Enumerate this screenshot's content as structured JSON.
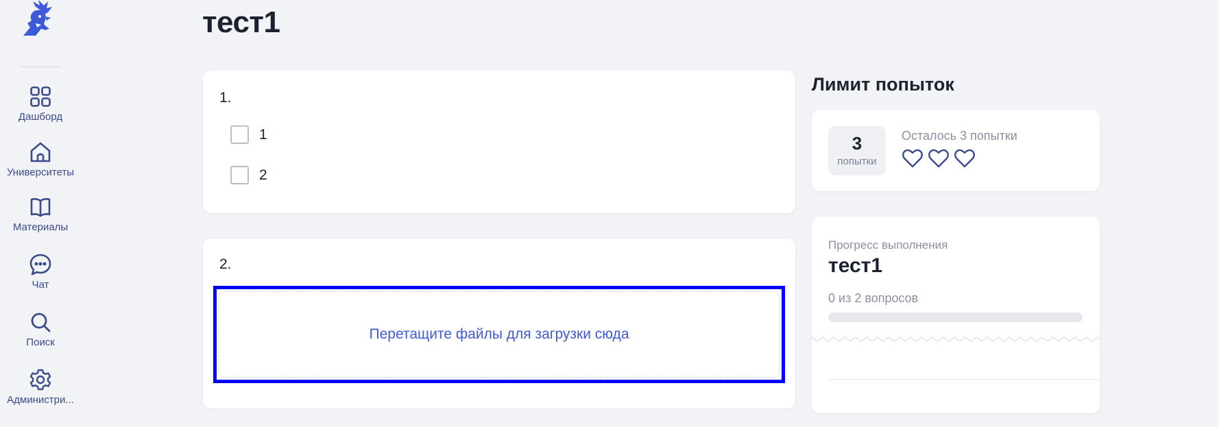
{
  "sidebar": {
    "items": [
      {
        "label": "Дашборд",
        "icon": "dashboard-icon"
      },
      {
        "label": "Университеты",
        "icon": "university-icon"
      },
      {
        "label": "Материалы",
        "icon": "book-icon"
      },
      {
        "label": "Чат",
        "icon": "chat-icon"
      },
      {
        "label": "Поиск",
        "icon": "search-icon"
      },
      {
        "label": "Администри...",
        "icon": "gear-icon"
      }
    ]
  },
  "page": {
    "title": "тест1"
  },
  "questions": [
    {
      "number": "1.",
      "options": [
        "1",
        "2"
      ]
    },
    {
      "number": "2.",
      "dropzone_text": "Перетащите файлы для загрузки сюда"
    }
  ],
  "attempts": {
    "heading": "Лимит попыток",
    "count": "3",
    "unit": "попытки",
    "remaining_text": "Осталось 3 попытки",
    "hearts": 3
  },
  "progress": {
    "label": "Прогресс выполнения",
    "title": "тест1",
    "count_text": "0 из 2 вопросов",
    "fraction": 0
  },
  "colors": {
    "accent": "#3f5ad9",
    "icon": "#3b4a8a",
    "highlight": "#0000ff",
    "background": "#f1f3f6"
  }
}
